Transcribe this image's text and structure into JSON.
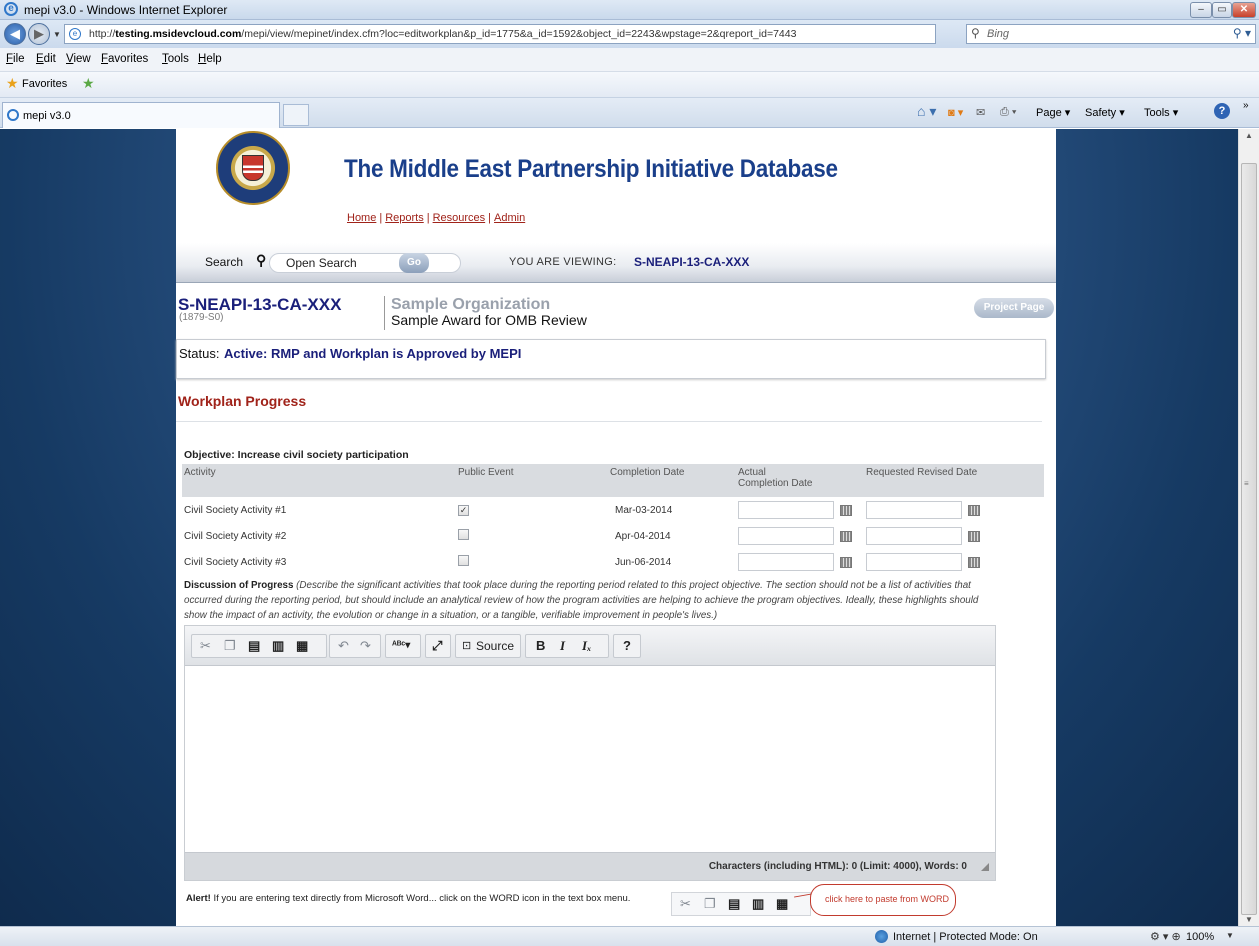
{
  "window": {
    "title": "mepi v3.0 - Windows Internet Explorer",
    "min": "–",
    "max": "▭",
    "close": "✕"
  },
  "address": {
    "url_prefix": "http://",
    "url_domain": "testing.msidevcloud.com",
    "url_path": "/mepi/view/mepinet/index.cfm?loc=editworkplan&p_id=1775&a_id=1592&object_id=2243&wpstage=2&qreport_id=7443",
    "search_placeholder": "Bing"
  },
  "menu": [
    "File",
    "Edit",
    "View",
    "Favorites",
    "Tools",
    "Help"
  ],
  "favorites": {
    "label": "Favorites"
  },
  "tab": {
    "label": "mepi v3.0"
  },
  "commandbar": {
    "page": "Page ▾",
    "safety": "Safety ▾",
    "tools": "Tools ▾",
    "help": "?",
    "more": "»"
  },
  "site": {
    "title": "The Middle East Partnership Initiative Database",
    "nav": [
      "Home",
      "Reports",
      "Resources",
      "Admin"
    ]
  },
  "search": {
    "label": "Search",
    "value": "Open Search",
    "go": "Go",
    "viewing_label": "YOU ARE VIEWING:",
    "viewing_value": "S-NEAPI-13-CA-XXX"
  },
  "project": {
    "id": "S-NEAPI-13-CA-XXX",
    "sub": "(1879-S0)",
    "org": "Sample Organization",
    "award": "Sample Award for OMB Review",
    "page_button": "Project Page"
  },
  "status": {
    "label": "Status:",
    "value": "Active: RMP and Workplan is Approved by MEPI"
  },
  "workplan": {
    "title": "Workplan Progress",
    "objective": "Objective: Increase civil society participation",
    "columns": [
      "Activity",
      "Public Event",
      "Completion Date",
      "Actual",
      "Completion Date",
      "Requested Revised Date"
    ],
    "rows": [
      {
        "activity": "Civil Society Activity #1",
        "public_event": true,
        "completion": "Mar-03-2014"
      },
      {
        "activity": "Civil Society Activity #2",
        "public_event": false,
        "completion": "Apr-04-2014"
      },
      {
        "activity": "Civil Society Activity #3",
        "public_event": false,
        "completion": "Jun-06-2014"
      }
    ],
    "discussion_label": "Discussion of Progress",
    "discussion_hint": "(Describe the significant activities that took place during the reporting period related to this project objective. The section should not be a list of activities that occurred during the reporting period, but should include an analytical review of how the program activities are helping to achieve the program objectives. Ideally, these highlights should show the impact of an activity, the evolution or change in a situation, or a tangible, verifiable improvement in people's lives.)"
  },
  "editor": {
    "source": "Source",
    "bold": "B",
    "italic": "I",
    "clear": "Iₓ",
    "help": "?",
    "char_count": "Characters (including HTML): 0 (Limit: 4000), Words: 0"
  },
  "alert": {
    "label": "Alert!",
    "text": "If you are entering text directly from Microsoft Word... click on the WORD icon in the text box menu.",
    "callout": "click here to paste from WORD"
  },
  "statusbar": {
    "zone": "Internet | Protected Mode: On",
    "zoom": "100%"
  }
}
